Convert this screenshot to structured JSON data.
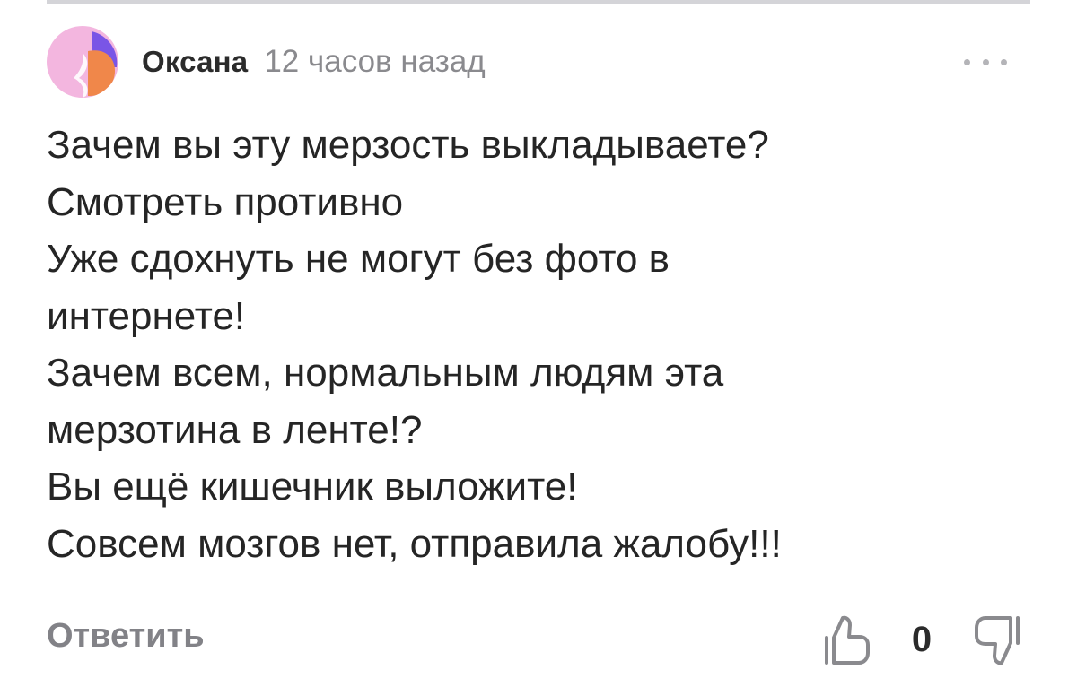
{
  "comment": {
    "author": "Оксана",
    "timestamp": "12 часов назад",
    "avatar_icon": "avatar-icon",
    "more_icon": "more-dots-icon",
    "body_lines": [
      "Зачем вы эту мерзость выкладываете?",
      "Смотреть противно",
      "Уже сдохнуть не могут без фото в",
      "интернете!",
      "Зачем всем, нормальным людям эта",
      "мерзотина в ленте!?",
      "Вы ещё кишечник выложите!",
      "Совсем мозгов нет, отправила жалобу!!!"
    ],
    "actions": {
      "reply_label": "Ответить",
      "like_icon": "thumbs-up-icon",
      "dislike_icon": "thumbs-down-icon",
      "vote_count": "0"
    }
  },
  "colors": {
    "avatar_pink": "#f3b6df",
    "avatar_orange": "#f0874a",
    "avatar_purple": "#7a55e6",
    "text_primary": "#252525",
    "text_secondary": "#8a8a8e",
    "divider": "#d4d4d8"
  }
}
